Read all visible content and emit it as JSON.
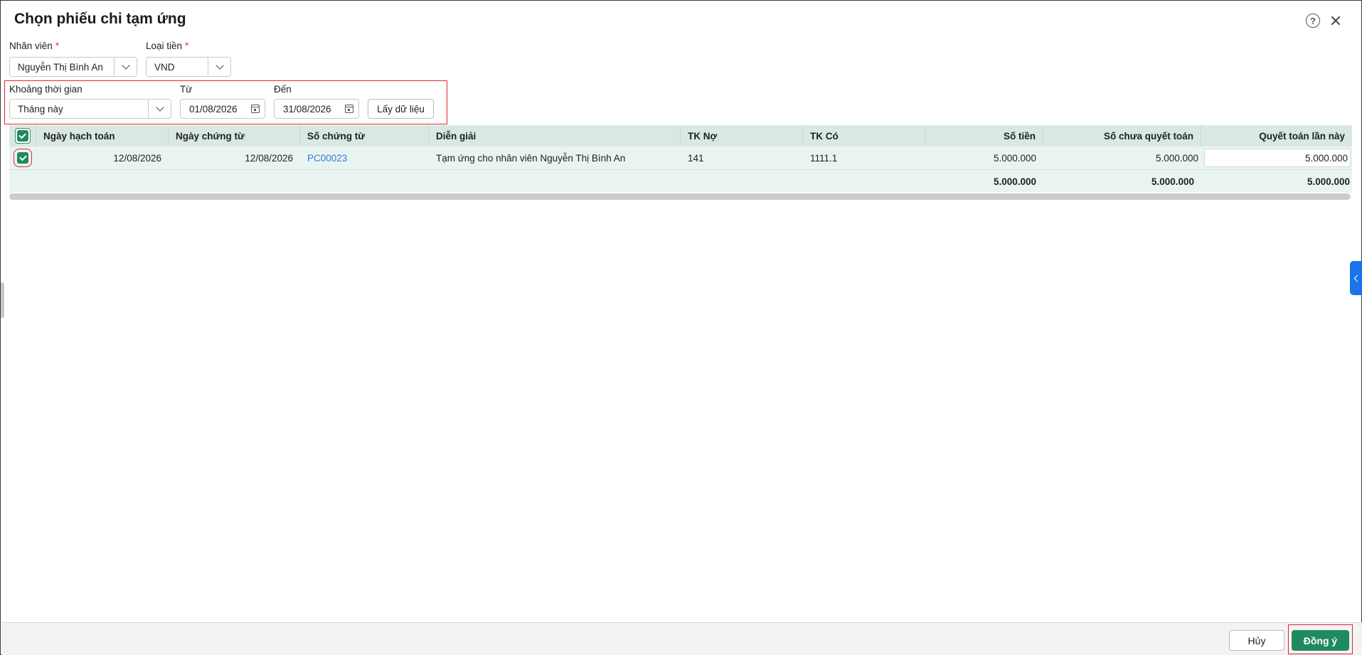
{
  "dialog": {
    "title": "Chọn phiếu chi tạm ứng",
    "help_symbol": "?"
  },
  "filters": {
    "employee_label": "Nhân viên",
    "employee_value": "Nguyễn Thị Bình An",
    "currency_label": "Loại tiền",
    "currency_value": "VND",
    "required_mark": "*",
    "period_label": "Khoảng thời gian",
    "period_value": "Tháng này",
    "from_label": "Từ",
    "from_value": "01/08/2026",
    "to_label": "Đến",
    "to_value": "31/08/2026",
    "fetch_button": "Lấy dữ liệu"
  },
  "table": {
    "columns": [
      "Ngày hạch toán",
      "Ngày chứng từ",
      "Số chứng từ",
      "Diễn giải",
      "TK Nợ",
      "TK Có",
      "Số tiền",
      "Số chưa quyết toán",
      "Quyết toán lần này"
    ],
    "rows": [
      {
        "checked": true,
        "posting_date": "12/08/2026",
        "doc_date": "12/08/2026",
        "doc_no": "PC00023",
        "description": "Tạm ứng cho nhân viên Nguyễn Thị Bình An",
        "debit_account": "141",
        "credit_account": "1111.1",
        "amount": "5.000.000",
        "unsettled": "5.000.000",
        "settle_now": "5.000.000"
      }
    ],
    "totals": {
      "amount": "5.000.000",
      "unsettled": "5.000.000",
      "settle_now": "5.000.000"
    }
  },
  "footer": {
    "cancel_label": "Hủy",
    "ok_label": "Đồng ý"
  },
  "colors": {
    "accent": "#1f8a5f",
    "header_bg": "#d9e8e2",
    "row_bg": "#e9f4f0",
    "highlight": "#e0262d",
    "link": "#2f7be5"
  }
}
